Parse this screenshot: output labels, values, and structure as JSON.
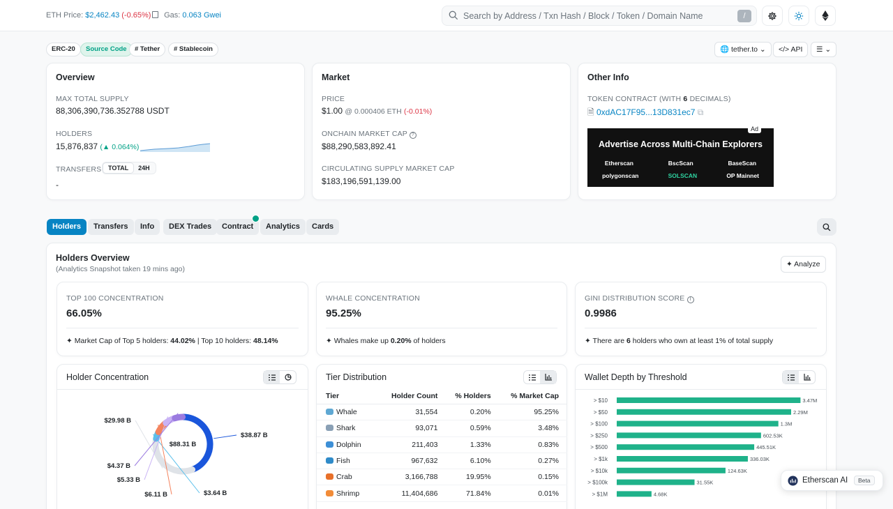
{
  "topbar": {
    "eth_price_label": "ETH Price:",
    "eth_price_value": "$2,462.43",
    "eth_price_change": "(-0.65%)",
    "gas_label": "Gas:",
    "gas_value": "0.063 Gwei",
    "search_placeholder": "Search by Address / Txn Hash / Block / Token / Domain Name",
    "search_shortcut": "/"
  },
  "tags": {
    "erc20": "ERC-20",
    "source_code": "Source Code",
    "tether": "# Tether",
    "stablecoin": "# Stablecoin"
  },
  "toolbar": {
    "site": "tether.to",
    "api": "API"
  },
  "overview": {
    "title": "Overview",
    "max_supply_label": "MAX TOTAL SUPPLY",
    "max_supply_value": "88,306,390,736.352788 USDT",
    "holders_label": "HOLDERS",
    "holders_value": "15,876,837",
    "holders_change": "0.064%",
    "transfers_label": "TRANSFERS",
    "transfers_total": "TOTAL",
    "transfers_24h": "24H",
    "transfers_value": "-"
  },
  "market": {
    "title": "Market",
    "price_label": "PRICE",
    "price_value": "$1.00",
    "price_eth": "@ 0.000406 ETH",
    "price_change": "(-0.01%)",
    "onchain_cap_label": "ONCHAIN MARKET CAP",
    "onchain_cap_value": "$88,290,583,892.41",
    "circ_cap_label": "CIRCULATING SUPPLY MARKET CAP",
    "circ_cap_value": "$183,196,591,139.00"
  },
  "other_info": {
    "title": "Other Info",
    "contract_label_pre": "TOKEN CONTRACT (WITH ",
    "contract_decimals": "6",
    "contract_label_post": " DECIMALS)",
    "contract_address": "0xdAC17F95...13D831ec7",
    "ad_tag": "Ad",
    "ad_title": "Advertise Across Multi-Chain Explorers",
    "ad_brands_row1": [
      "Etherscan",
      "BscScan",
      "BaseScan"
    ],
    "ad_brands_row2": [
      "polygonscan",
      "SOLSCAN",
      "OP Mainnet"
    ]
  },
  "tabs": [
    "Holders",
    "Transfers",
    "Info",
    "DEX Trades",
    "Contract",
    "Analytics",
    "Cards"
  ],
  "holders_overview": {
    "title": "Holders Overview",
    "subtitle": "(Analytics Snapshot taken 19 mins ago)",
    "analyze_label": "Analyze",
    "top100": {
      "label": "TOP 100 CONCENTRATION",
      "value": "66.05%",
      "note_pre": "Market Cap of Top 5 holders: ",
      "note_b1": "44.02%",
      "note_mid": " | Top 10 holders: ",
      "note_b2": "48.14%"
    },
    "whale": {
      "label": "WHALE CONCENTRATION",
      "value": "95.25%",
      "note_pre": "Whales make up ",
      "note_b1": "0.20%",
      "note_post": " of holders"
    },
    "gini": {
      "label": "GINI DISTRIBUTION SCORE",
      "value": "0.9986",
      "note_pre": "There are ",
      "note_b1": "6",
      "note_post": " holders who own at least 1% of total supply"
    }
  },
  "holder_concentration": {
    "title": "Holder Concentration",
    "center_label": "$88.31 B",
    "labels": [
      "$38.87 B",
      "$29.98 B",
      "$4.37 B",
      "$5.33 B",
      "$6.11 B",
      "$3.64 B"
    ]
  },
  "tier_distribution": {
    "title": "Tier Distribution",
    "headers": [
      "Tier",
      "Holder Count",
      "% Holders",
      "% Market Cap"
    ],
    "rows": [
      {
        "tier": "Whale",
        "count": "31,554",
        "pct_holders": "0.20%",
        "pct_cap": "95.25%",
        "color": "#5fa8d3"
      },
      {
        "tier": "Shark",
        "count": "93,071",
        "pct_holders": "0.59%",
        "pct_cap": "3.48%",
        "color": "#8aa0b5"
      },
      {
        "tier": "Dolphin",
        "count": "211,403",
        "pct_holders": "1.33%",
        "pct_cap": "0.83%",
        "color": "#3d8fd6"
      },
      {
        "tier": "Fish",
        "count": "967,632",
        "pct_holders": "6.10%",
        "pct_cap": "0.27%",
        "color": "#2f8bc9"
      },
      {
        "tier": "Crab",
        "count": "3,166,788",
        "pct_holders": "19.95%",
        "pct_cap": "0.15%",
        "color": "#e8702a"
      },
      {
        "tier": "Shrimp",
        "count": "11,404,686",
        "pct_holders": "71.84%",
        "pct_cap": "0.01%",
        "color": "#f28c38"
      }
    ]
  },
  "wallet_depth": {
    "title": "Wallet Depth by Threshold"
  },
  "chart_data": [
    {
      "type": "pie",
      "title": "Holder Concentration",
      "center_label": "$88.31 B",
      "labels": [
        "$38.87 B",
        "$29.98 B",
        "$3.64 B",
        "$6.11 B",
        "$5.33 B",
        "$4.37 B"
      ],
      "values": [
        38.87,
        29.98,
        3.64,
        6.11,
        5.33,
        4.37
      ],
      "colors": [
        "#1a56db",
        "#dfe3e8",
        "#5bc0eb",
        "#f4845f",
        "#c9b3f5",
        "#9b7be0"
      ]
    },
    {
      "type": "bar",
      "orientation": "horizontal",
      "title": "Wallet Depth by Threshold",
      "categories": [
        "> $10",
        "> $50",
        "> $100",
        "> $250",
        "> $500",
        "> $1k",
        "> $10k",
        "> $100k",
        "> $1M"
      ],
      "values": [
        3470000,
        2290000,
        1300000,
        602530,
        445510,
        336030,
        124630,
        31550,
        4680
      ],
      "value_labels": [
        "3.47M",
        "2.29M",
        "1.3M",
        "602.53K",
        "445.51K",
        "336.03K",
        "124.63K",
        "31.55K",
        "4.68K"
      ],
      "scale": "log",
      "color": "#1fb28a"
    }
  ],
  "ai_widget": {
    "label": "Etherscan AI",
    "beta": "Beta"
  }
}
